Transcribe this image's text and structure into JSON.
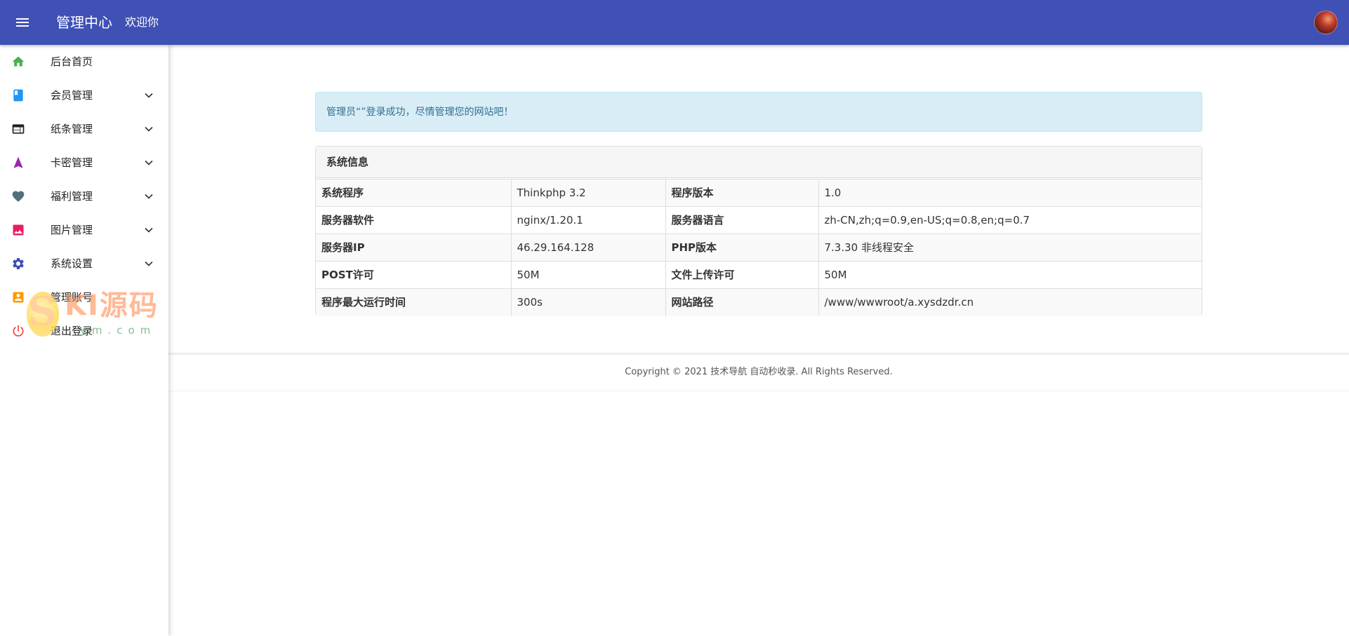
{
  "header": {
    "title": "管理中心",
    "welcome": "欢迎你",
    "bar_color": "#3f51b5"
  },
  "sidebar": {
    "items": [
      {
        "label": "后台首页",
        "icon": "home-icon",
        "color": "#4caf50",
        "has_submenu": false
      },
      {
        "label": "会员管理",
        "icon": "book-icon",
        "color": "#2196f3",
        "has_submenu": true
      },
      {
        "label": "纸条管理",
        "icon": "web-icon",
        "color": "#212121",
        "has_submenu": true
      },
      {
        "label": "卡密管理",
        "icon": "navigation-icon",
        "color": "#9c27b0",
        "has_submenu": true
      },
      {
        "label": "福利管理",
        "icon": "heart-icon",
        "color": "#546e7a",
        "has_submenu": true
      },
      {
        "label": "图片管理",
        "icon": "image-icon",
        "color": "#e91e63",
        "has_submenu": true
      },
      {
        "label": "系统设置",
        "icon": "gear-icon",
        "color": "#3f51b5",
        "has_submenu": true
      },
      {
        "label": "管理账号",
        "icon": "account-box-icon",
        "color": "#ff9800",
        "has_submenu": false
      },
      {
        "label": "退出登录",
        "icon": "power-icon",
        "color": "#f44336",
        "has_submenu": false
      }
    ]
  },
  "watermark": {
    "letter": "S",
    "text": "KI源码",
    "sub": "ym.com"
  },
  "alert": {
    "text": "管理员“”登录成功，尽情管理您的网站吧！"
  },
  "system_info": {
    "title": "系统信息",
    "rows": [
      {
        "k1": "系统程序",
        "v1": "Thinkphp 3.2",
        "k2": "程序版本",
        "v2": "1.0"
      },
      {
        "k1": "服务器软件",
        "v1": "nginx/1.20.1",
        "k2": "服务器语言",
        "v2": "zh-CN,zh;q=0.9,en-US;q=0.8,en;q=0.7"
      },
      {
        "k1": "服务器IP",
        "v1": "46.29.164.128",
        "k2": "PHP版本",
        "v2": "7.3.30 非线程安全"
      },
      {
        "k1": "POST许可",
        "v1": "50M",
        "k2": "文件上传许可",
        "v2": "50M"
      },
      {
        "k1": "程序最大运行时间",
        "v1": "300s",
        "k2": "网站路径",
        "v2": "/www/wwwroot/a.xysdzdr.cn"
      }
    ]
  },
  "footer": {
    "text": "Copyright © 2021 技术导航 自动秒收录. All Rights Reserved."
  }
}
